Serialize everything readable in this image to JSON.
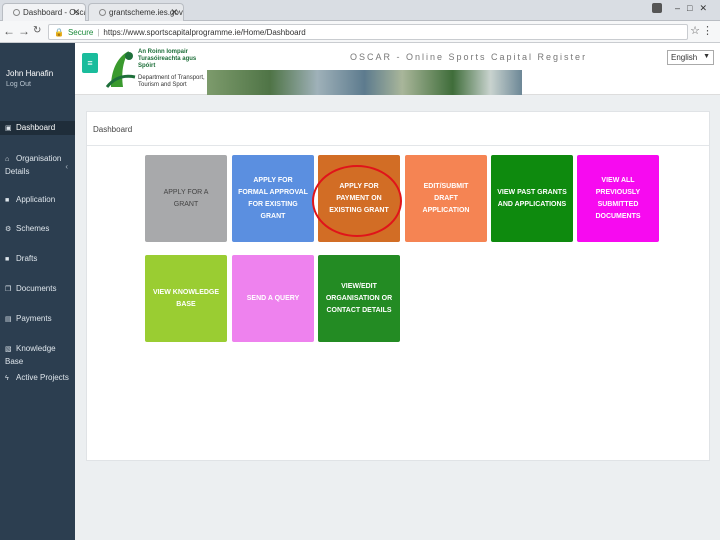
{
  "browser": {
    "tabs": [
      {
        "label": "Dashboard - Oscar"
      },
      {
        "label": "grantscheme.ies.gov.ie"
      }
    ],
    "url_secure_label": "Secure",
    "url": "https://www.sportscapitalprogramme.ie/Home/Dashboard"
  },
  "header": {
    "user_name": "John Hanafin",
    "logout_label": "Log Out",
    "site_title": "OSCAR - Online Sports Capital Register",
    "logo_lines": [
      "An Roinn Iompair",
      "Turasóireachta agus",
      "Spóirt",
      "Department of Transport,",
      "Tourism and Sport"
    ],
    "language": "English"
  },
  "sidebar": {
    "items": [
      {
        "label": "Dashboard",
        "icon": "dashboard-icon",
        "glyph": "▣"
      },
      {
        "label": "Organisation Details",
        "icon": "home-icon",
        "glyph": "⌂"
      },
      {
        "label": "Application",
        "icon": "file-icon",
        "glyph": "■"
      },
      {
        "label": "Schemes",
        "icon": "cogs-icon",
        "glyph": "⚙"
      },
      {
        "label": "Drafts",
        "icon": "draft-icon",
        "glyph": "■"
      },
      {
        "label": "Documents",
        "icon": "documents-icon",
        "glyph": "❐"
      },
      {
        "label": "Payments",
        "icon": "payments-icon",
        "glyph": "▤"
      },
      {
        "label": "Knowledge Base",
        "icon": "book-icon",
        "glyph": "▧"
      },
      {
        "label": "Active Projects",
        "icon": "bolt-icon",
        "glyph": "ϟ"
      }
    ]
  },
  "main": {
    "panel_title": "Dashboard",
    "tiles": [
      {
        "label": "APPLY FOR A GRANT",
        "color": "#a8a9ab"
      },
      {
        "label": "APPLY FOR FORMAL APPROVAL FOR EXISTING GRANT",
        "color": "#5b8fe0"
      },
      {
        "label": "APPLY FOR PAYMENT ON EXISTING GRANT",
        "color": "#d26d25"
      },
      {
        "label": "EDIT/SUBMIT DRAFT APPLICATION",
        "color": "#f58453"
      },
      {
        "label": "VIEW PAST GRANTS AND APPLICATIONS",
        "color": "#0e8a0e"
      },
      {
        "label": "VIEW ALL PREVIOUSLY SUBMITTED DOCUMENTS",
        "color": "#f70af0"
      },
      {
        "label": "VIEW KNOWLEDGE BASE",
        "color": "#9acd32"
      },
      {
        "label": "SEND A QUERY",
        "color": "#ee82ee"
      },
      {
        "label": "VIEW/EDIT ORGANISATION OR CONTACT DETAILS",
        "color": "#238b23"
      }
    ]
  }
}
